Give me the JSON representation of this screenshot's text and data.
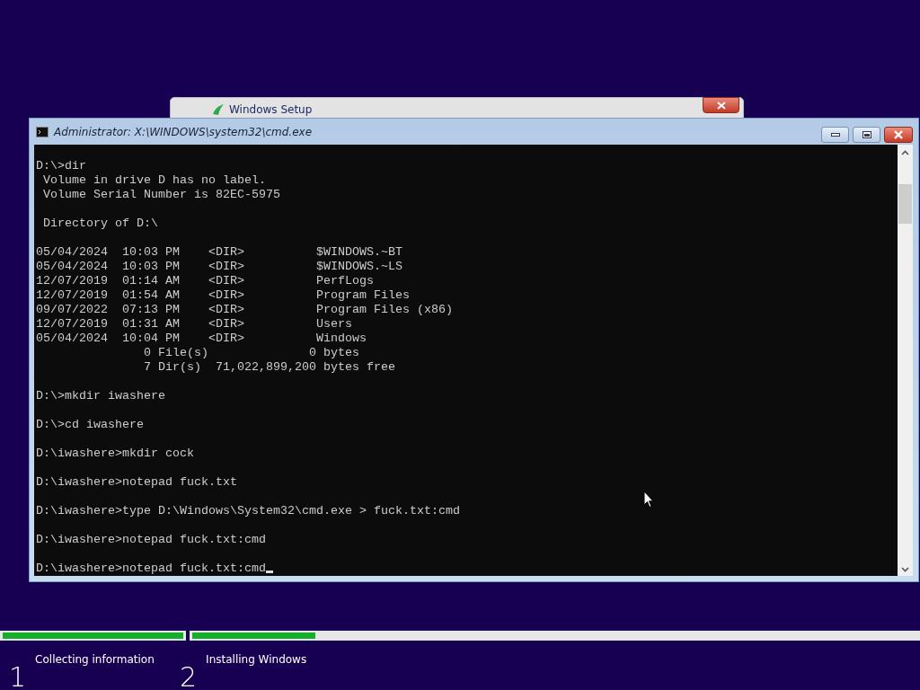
{
  "background_window": {
    "title": "Windows Setup"
  },
  "console_window": {
    "title": "Administrator: X:\\WINDOWS\\system32\\cmd.exe",
    "lines": [
      {
        "kind": "text",
        "text": "D:\\>dir",
        "cursor": false
      },
      {
        "kind": "text",
        "text": " Volume in drive D has no label.",
        "cursor": false
      },
      {
        "kind": "text",
        "text": " Volume Serial Number is 82EC-5975",
        "cursor": false
      },
      {
        "kind": "blank"
      },
      {
        "kind": "text",
        "text": " Directory of D:\\",
        "cursor": false
      },
      {
        "kind": "blank"
      },
      {
        "kind": "text",
        "text": "05/04/2024  10:03 PM    <DIR>          $WINDOWS.~BT",
        "cursor": false
      },
      {
        "kind": "text",
        "text": "05/04/2024  10:03 PM    <DIR>          $WINDOWS.~LS",
        "cursor": false
      },
      {
        "kind": "text",
        "text": "12/07/2019  01:14 AM    <DIR>          PerfLogs",
        "cursor": false
      },
      {
        "kind": "text",
        "text": "12/07/2019  01:54 AM    <DIR>          Program Files",
        "cursor": false
      },
      {
        "kind": "text",
        "text": "09/07/2022  07:13 PM    <DIR>          Program Files (x86)",
        "cursor": false
      },
      {
        "kind": "text",
        "text": "12/07/2019  01:31 AM    <DIR>          Users",
        "cursor": false
      },
      {
        "kind": "text",
        "text": "05/04/2024  10:04 PM    <DIR>          Windows",
        "cursor": false
      },
      {
        "kind": "text",
        "text": "               0 File(s)              0 bytes",
        "cursor": false
      },
      {
        "kind": "text",
        "text": "               7 Dir(s)  71,022,899,200 bytes free",
        "cursor": false
      },
      {
        "kind": "blank"
      },
      {
        "kind": "text",
        "text": "D:\\>mkdir iwashere",
        "cursor": false
      },
      {
        "kind": "blank"
      },
      {
        "kind": "text",
        "text": "D:\\>cd iwashere",
        "cursor": false
      },
      {
        "kind": "blank"
      },
      {
        "kind": "text",
        "text": "D:\\iwashere>mkdir cock",
        "cursor": false
      },
      {
        "kind": "blank"
      },
      {
        "kind": "text",
        "text": "D:\\iwashere>notepad fuck.txt",
        "cursor": false
      },
      {
        "kind": "blank"
      },
      {
        "kind": "text",
        "text": "D:\\iwashere>type D:\\Windows\\System32\\cmd.exe > fuck.txt:cmd",
        "cursor": false
      },
      {
        "kind": "blank"
      },
      {
        "kind": "text",
        "text": "D:\\iwashere>notepad fuck.txt:cmd",
        "cursor": false
      },
      {
        "kind": "blank"
      },
      {
        "kind": "text",
        "text": "D:\\iwashere>notepad fuck.txt:cmd",
        "cursor": true
      }
    ]
  },
  "progress": {
    "steps": [
      {
        "number": "1",
        "label": "Collecting information",
        "level": 1
      },
      {
        "number": "2",
        "label": "Installing Windows",
        "level": 0.17
      }
    ]
  }
}
